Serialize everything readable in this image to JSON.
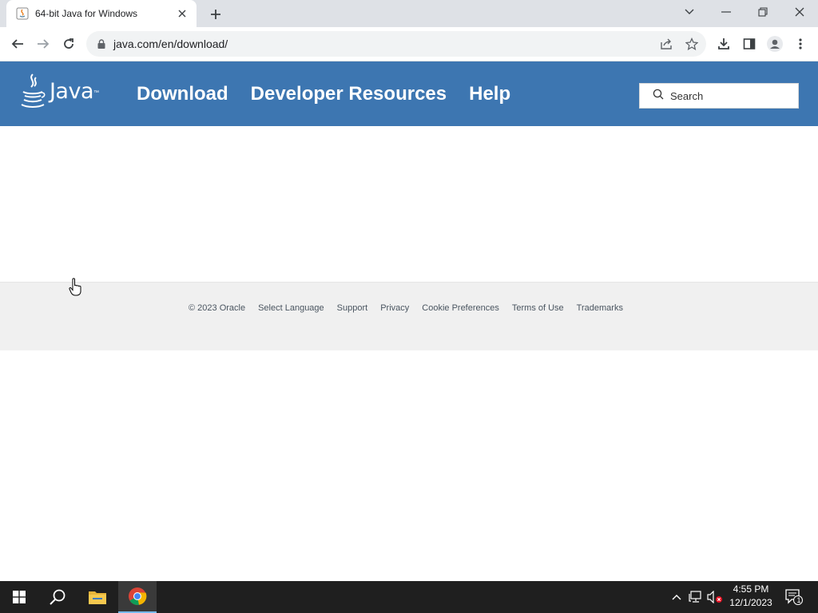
{
  "browser": {
    "tab": {
      "title": "64-bit Java for Windows"
    },
    "address_bar": {
      "url": "java.com/en/download/"
    }
  },
  "site": {
    "logo_text": "Java",
    "logo_tm": "™",
    "nav": {
      "download": "Download",
      "developer_resources": "Developer Resources",
      "help": "Help"
    },
    "search": {
      "placeholder": "Search"
    },
    "colors": {
      "header_bg": "#3d76b1",
      "footer_bg": "#f0f0f0"
    }
  },
  "footer": {
    "copyright": "© 2023 Oracle",
    "select_language": "Select Language",
    "support": "Support",
    "privacy": "Privacy",
    "cookie_preferences": "Cookie Preferences",
    "terms_of_use": "Terms of Use",
    "trademarks": "Trademarks"
  },
  "taskbar": {
    "time": "4:55 PM",
    "date": "12/1/2023",
    "notification_count": "1",
    "pinned": [
      "windows-start-icon",
      "search-icon",
      "file-explorer-icon",
      "chrome-icon"
    ]
  }
}
